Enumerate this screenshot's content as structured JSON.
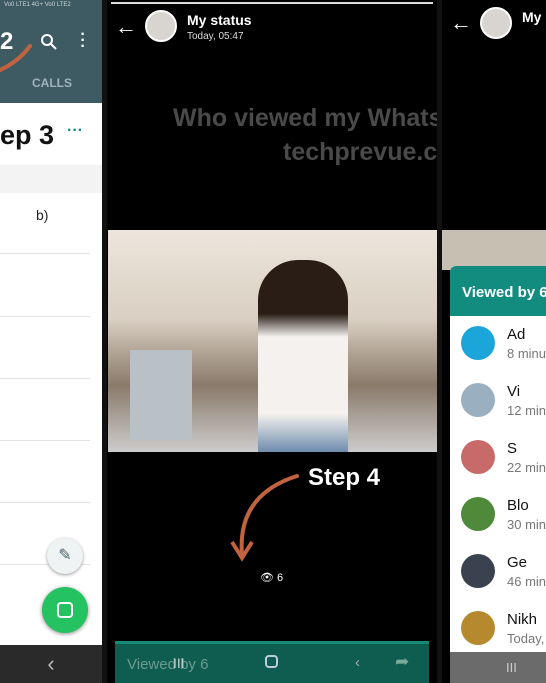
{
  "left": {
    "status_icons": "Vo0 LTE1 4G+ Vo0 LTE2",
    "header_partial": "2",
    "tab_calls": "CALLS",
    "step_label": "ep 3",
    "menu_dots": "···",
    "row_text": "b)",
    "nav_back": "‹"
  },
  "middle": {
    "title": "My status",
    "time": "Today, 05:47",
    "watermark_line1": "Who viewed my WhatsApp St",
    "watermark_line2": "techprevue.com",
    "step_label": "Step 4",
    "view_count": "6",
    "bottom_bar_label": "Viewed by 6",
    "nav_recent": "III",
    "nav_home": "○"
  },
  "right": {
    "title_partial": "My",
    "sheet_title": "Viewed by 6",
    "viewers": [
      {
        "name": "Ad",
        "time": "8 minu",
        "color": "#1ba5d8"
      },
      {
        "name": "Vi",
        "time": "12 min",
        "color": "#9ab0c0"
      },
      {
        "name": "S",
        "time": "22 min",
        "color": "#c86a6a"
      },
      {
        "name": "Blo",
        "time": "30 min",
        "color": "#4e8a3a"
      },
      {
        "name": "Ge",
        "time": "46 min",
        "color": "#3a4250"
      },
      {
        "name": "Nikh",
        "time": "Today,",
        "color": "#b7892e"
      }
    ],
    "nav_recent": "III"
  },
  "colors": {
    "teal_header": "#3e5b63",
    "whatsapp_green": "#25c261",
    "sheet_teal": "#128c7e",
    "arrow": "#c0633e"
  }
}
